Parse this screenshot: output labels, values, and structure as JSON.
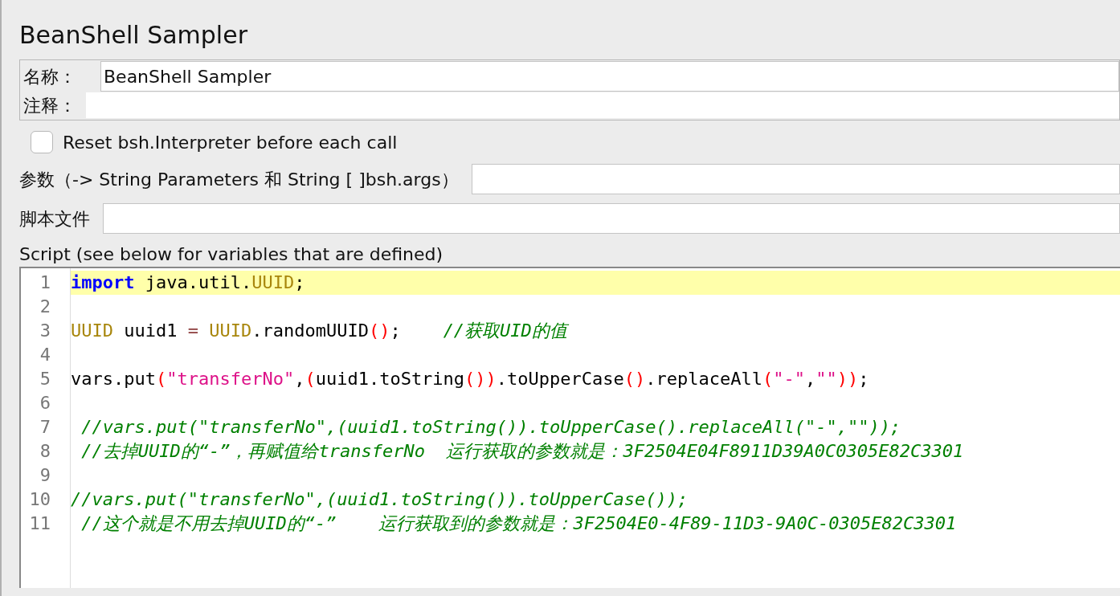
{
  "title": "BeanShell Sampler",
  "name_field": {
    "label": "名称：",
    "value": "BeanShell Sampler"
  },
  "comment_field": {
    "label": "注释："
  },
  "reset_checkbox": {
    "label": "Reset bsh.Interpreter before each call",
    "checked": false
  },
  "parameters_field": {
    "label": "参数（-> String Parameters 和 String [ ]bsh.args）"
  },
  "script_file_field": {
    "label": "脚本文件"
  },
  "script": {
    "label": "Script (see below for variables that are defined)",
    "lines": [
      {
        "number": "1",
        "highlighted": true,
        "tokens": [
          {
            "kind": "keyword",
            "text": "import"
          },
          {
            "kind": "plain",
            "text": " java.util."
          },
          {
            "kind": "type",
            "text": "UUID"
          },
          {
            "kind": "plain",
            "text": ";"
          }
        ]
      },
      {
        "number": "2"
      },
      {
        "number": "3",
        "highlighted": false,
        "tokens": [
          {
            "kind": "type",
            "text": "UUID"
          },
          {
            "kind": "plain",
            "text": " uuid1 "
          },
          {
            "kind": "operator",
            "text": "= "
          },
          {
            "kind": "type",
            "text": "UUID"
          },
          {
            "kind": "plain",
            "text": ".randomUUID"
          },
          {
            "kind": "paren",
            "text": "()"
          },
          {
            "kind": "plain",
            "text": ";    "
          },
          {
            "kind": "comment",
            "text": "//获取UID的值"
          }
        ]
      },
      {
        "number": "4"
      },
      {
        "number": "5",
        "highlighted": false,
        "tokens": [
          {
            "kind": "plain",
            "text": "vars.put"
          },
          {
            "kind": "paren",
            "text": "("
          },
          {
            "kind": "string",
            "text": "\"transferNo\""
          },
          {
            "kind": "plain",
            "text": ","
          },
          {
            "kind": "paren",
            "text": "("
          },
          {
            "kind": "plain",
            "text": "uuid1.toString"
          },
          {
            "kind": "paren",
            "text": "())"
          },
          {
            "kind": "plain",
            "text": ".toUpperCase"
          },
          {
            "kind": "paren",
            "text": "()"
          },
          {
            "kind": "plain",
            "text": ".replaceAll"
          },
          {
            "kind": "paren",
            "text": "("
          },
          {
            "kind": "string",
            "text": "\"-\""
          },
          {
            "kind": "plain",
            "text": ","
          },
          {
            "kind": "string",
            "text": "\"\""
          },
          {
            "kind": "paren",
            "text": "))"
          },
          {
            "kind": "plain",
            "text": ";"
          }
        ]
      },
      {
        "number": "6"
      },
      {
        "number": "7",
        "highlighted": false,
        "tokens": [
          {
            "kind": "comment",
            "text": " //vars.put(\"transferNo\",(uuid1.toString()).toUpperCase().replaceAll(\"-\",\"\"));"
          }
        ]
      },
      {
        "number": "8",
        "highlighted": false,
        "tokens": [
          {
            "kind": "comment",
            "text": " //去掉UUID的“-”，再赋值给transferNo  运行获取的参数就是：3F2504E04F8911D39A0C0305E82C3301"
          }
        ]
      },
      {
        "number": "9"
      },
      {
        "number": "10",
        "highlighted": false,
        "tokens": [
          {
            "kind": "comment",
            "text": "//vars.put(\"transferNo\",(uuid1.toString()).toUpperCase());"
          }
        ]
      },
      {
        "number": "11",
        "highlighted": false,
        "tokens": [
          {
            "kind": "comment",
            "text": " //这个就是不用去掉UUID的“-”    运行获取到的参数就是：3F2504E0-4F89-11D3-9A0C-0305E82C3301"
          }
        ]
      }
    ]
  }
}
